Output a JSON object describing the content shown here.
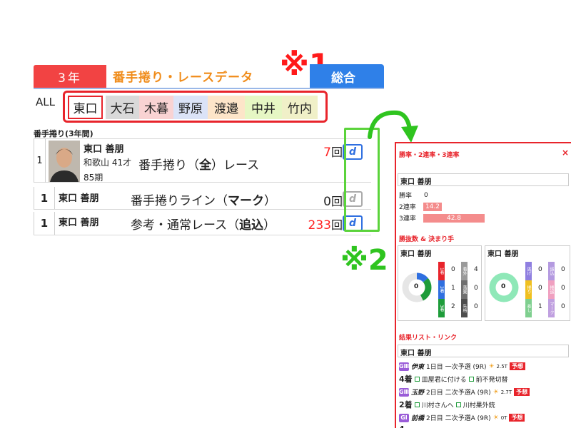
{
  "header": {
    "grade_tab": "3年",
    "section_title": "番手捲り・レースデータ",
    "note1": "※1",
    "total_tab": "総合"
  },
  "tabs": {
    "all_label": "ALL",
    "racers": [
      "東口",
      "大石",
      "木暮",
      "野原",
      "渡邉",
      "中井",
      "竹内"
    ],
    "colors": [
      "#ffffff",
      "#d9d9d9",
      "#f9d3d3",
      "#dbe3f7",
      "#fde5c9",
      "#e6f7c4",
      "#f0f0c8"
    ]
  },
  "table": {
    "caption": "番手捲り(3年間)",
    "row1": {
      "num": "1",
      "name": "東口 善朋",
      "region_age": "和歌山 41才",
      "term": "85期",
      "desc_pre": "番手捲り（",
      "desc_bold": "全",
      "desc_post": "）レース",
      "count": "7",
      "unit": "回",
      "btn": "d"
    },
    "row2": {
      "num": "1",
      "name": "東口 善朋",
      "desc_pre": "番手捲りライン（",
      "desc_bold": "マーク",
      "desc_post": "）",
      "count": "0",
      "unit": "回",
      "btn": "d"
    },
    "row3": {
      "num": "1",
      "name": "東口 善朋",
      "desc_pre": "参考・通常レース（",
      "desc_bold": "追込",
      "desc_post": "）",
      "count": "233",
      "unit": "回",
      "btn": "d"
    }
  },
  "note2": "※2",
  "panel": {
    "close": "×",
    "rates_title": "勝率・2連率・3連率",
    "name": "東口 善朋",
    "rates": [
      {
        "label": "勝率",
        "value": "0",
        "fill": 0
      },
      {
        "label": "2連率",
        "value": "14.2",
        "fill": 0.142
      },
      {
        "label": "3連率",
        "value": "42.8",
        "fill": 0.428
      }
    ],
    "kimarite_title": "勝抜数 & 決まり手",
    "left_box": {
      "name": "東口 善朋",
      "center": "0",
      "bars": [
        {
          "label": "1着",
          "color": "#e8242b",
          "value": "0"
        },
        {
          "label": "2着",
          "color": "#2f6fe0",
          "value": "1"
        },
        {
          "label": "3着",
          "color": "#1e9c3a",
          "value": "2"
        }
      ],
      "bars2": [
        {
          "label": "着外",
          "color": "#9a9a9a",
          "value": "4"
        },
        {
          "label": "落棄",
          "color": "#6f6f6f",
          "value": "0"
        },
        {
          "label": "失格",
          "color": "#4d4d4d",
          "value": "0"
        }
      ]
    },
    "right_box": {
      "name": "東口 善朋",
      "center": "0",
      "bars": [
        {
          "label": "逃げ",
          "color": "#8f7fe0",
          "value": "0"
        },
        {
          "label": "捲り",
          "color": "#f0c020",
          "value": "0"
        },
        {
          "label": "差し",
          "color": "#7fcf8f",
          "value": "1"
        }
      ],
      "bars2": [
        {
          "label": "追込",
          "color": "#b49ae0",
          "value": "0"
        },
        {
          "label": "捲追",
          "color": "#f0a0c0",
          "value": "0"
        },
        {
          "label": "マーク",
          "color": "#c0a0e0",
          "value": "0"
        }
      ]
    },
    "results_title": "結果リスト・リンク",
    "results_name": "東口 善朋",
    "results": [
      {
        "grade": "GⅢ",
        "grade_color": "#9a5cd8",
        "venue": "伊東",
        "line": "1日目 一次予選 (9R)",
        "odds": "2.5T",
        "yoso": "予想",
        "place": "4着",
        "comment": "皿屋君に付ける",
        "comment2": "前不発切替"
      },
      {
        "grade": "GⅢ",
        "grade_color": "#9a5cd8",
        "venue": "玉野",
        "line": "2日目 二次予選A (9R)",
        "odds": "2.7T",
        "yoso": "予想",
        "place": "2着",
        "comment": "川村さんへ",
        "comment2": "川村果外銃"
      },
      {
        "grade": "GⅠ",
        "grade_color": "#9a5cd8",
        "venue": "前橋",
        "line": "2日目 二次予選A (9R)",
        "odds": "0T",
        "yoso": "予想",
        "place": "4",
        "comment": "",
        "comment2": ""
      }
    ]
  }
}
